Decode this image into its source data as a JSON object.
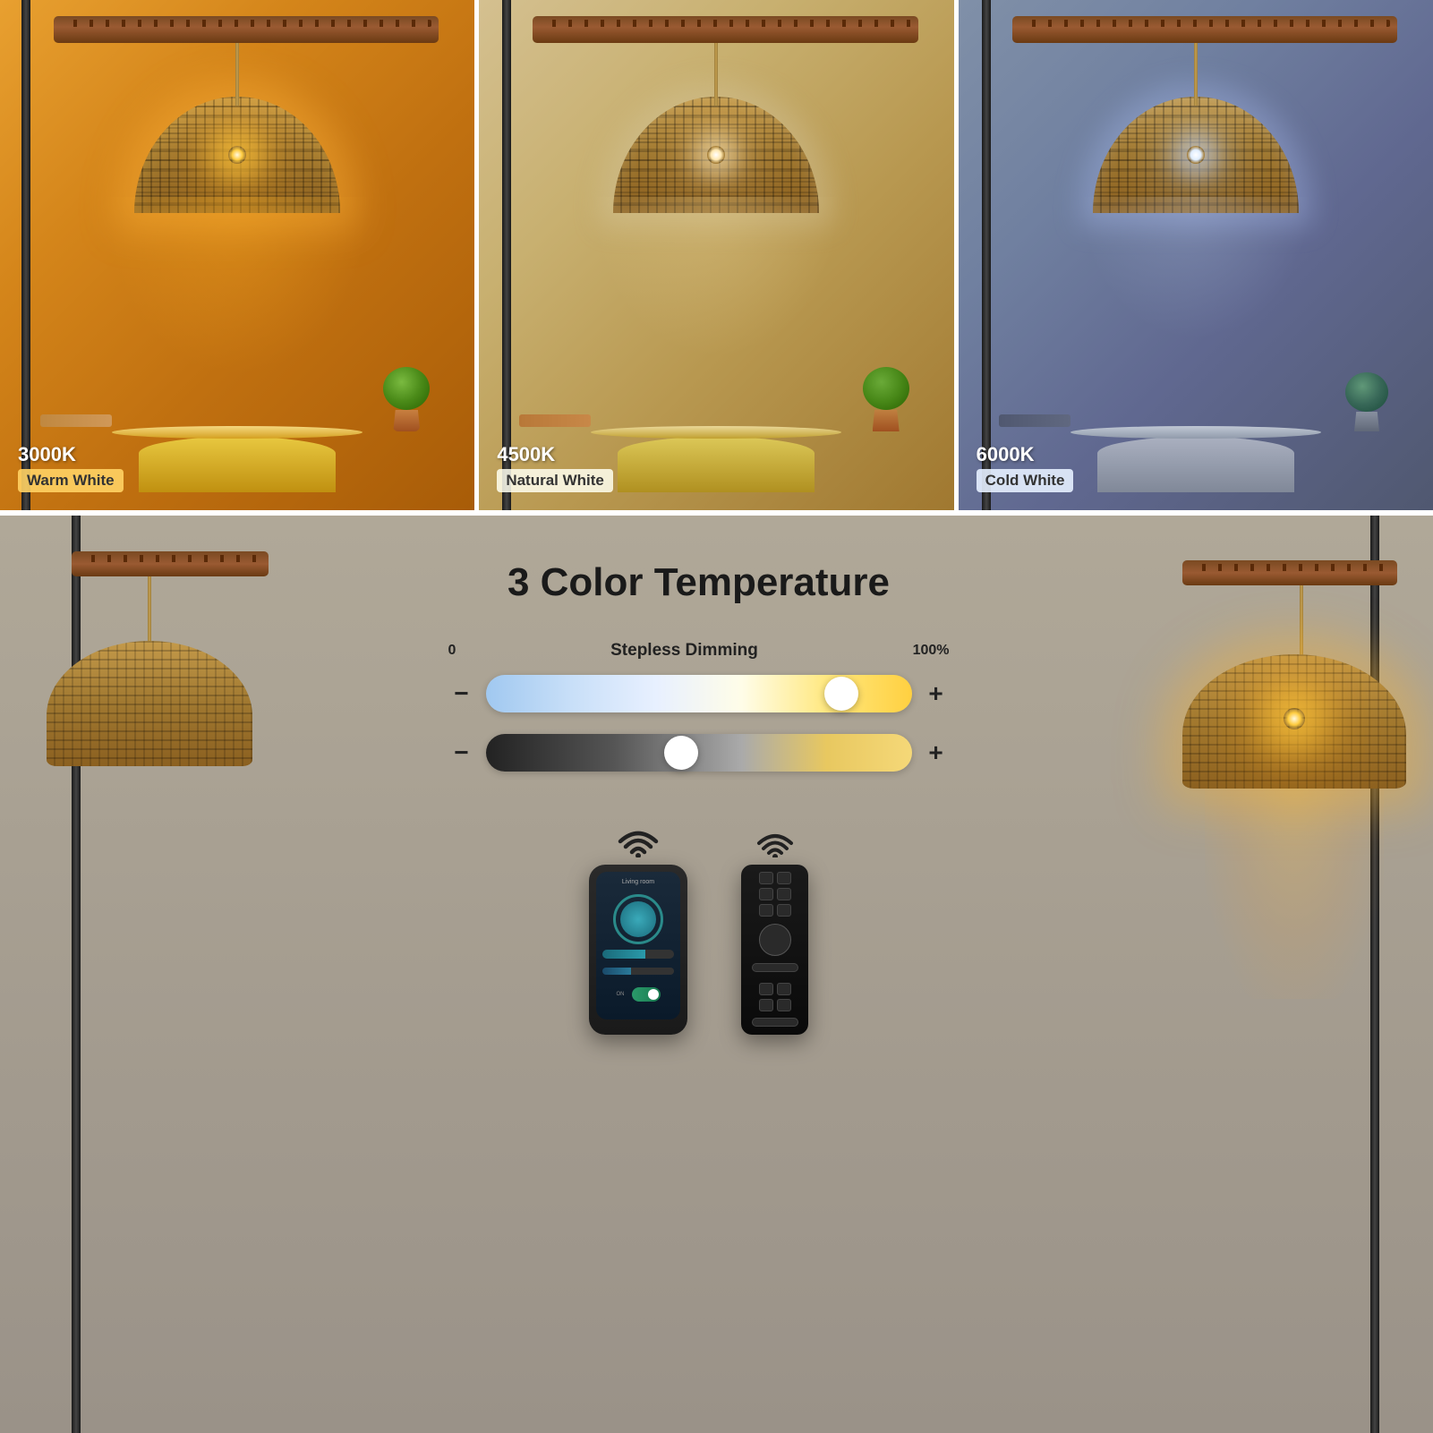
{
  "top": {
    "panels": [
      {
        "id": "warm",
        "kelvin": "3000K",
        "type_label": "Warm White",
        "badge_class": "badge-warm",
        "theme": "warm"
      },
      {
        "id": "natural",
        "kelvin": "4500K",
        "type_label": "Natural White",
        "badge_class": "badge-natural",
        "theme": "natural"
      },
      {
        "id": "cold",
        "kelvin": "6000K",
        "type_label": "Cold White",
        "badge_class": "badge-cold",
        "theme": "cold"
      }
    ]
  },
  "bottom": {
    "title": "3 Color Temperature",
    "dimming": {
      "label": "Stepless Dimming",
      "min": "0",
      "max": "100%",
      "minus": "−",
      "plus": "+"
    },
    "phone": {
      "header": "Living room",
      "toggle_label": ""
    },
    "remote": {}
  },
  "icons": {
    "wifi": "wifi-icon",
    "minus": "−",
    "plus": "+"
  }
}
